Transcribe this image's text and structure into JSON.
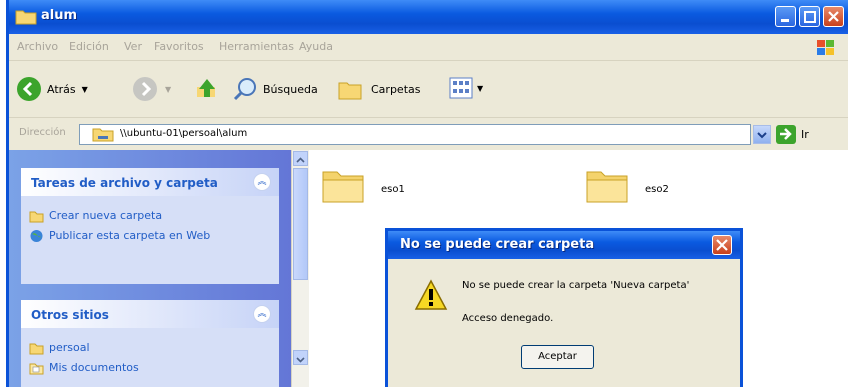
{
  "window": {
    "title": "alum",
    "menu": [
      "Archivo",
      "Edición",
      "Ver",
      "Favoritos",
      "Herramientas",
      "Ayuda"
    ],
    "toolbar": {
      "back_label": "Atrás",
      "search_label": "Búsqueda",
      "folders_label": "Carpetas"
    },
    "address": {
      "label": "Dirección",
      "value": "\\\\ubuntu-01\\persoal\\alum",
      "go_label": "Ir"
    }
  },
  "sidebar": {
    "tasks_panel": {
      "title": "Tareas de archivo y carpeta",
      "items": [
        "Crear nueva carpeta",
        "Publicar esta carpeta en Web"
      ]
    },
    "places_panel": {
      "title": "Otros sitios",
      "items": [
        "persoal",
        "Mis documentos"
      ]
    }
  },
  "content": {
    "folders": [
      "eso1",
      "eso2"
    ]
  },
  "dialog": {
    "title": "No se puede crear carpeta",
    "message": "No se puede crear la carpeta 'Nueva carpeta'",
    "detail": "Acceso denegado.",
    "ok_label": "Aceptar"
  },
  "colors": {
    "titlebar": "#0a5ae0",
    "sidebar_link": "#215dc6",
    "window_bg": "#ece9d8"
  }
}
